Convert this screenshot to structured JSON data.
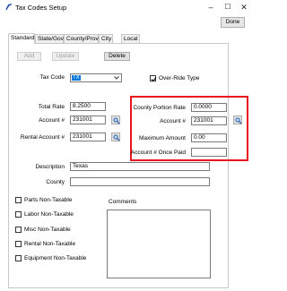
{
  "window": {
    "title": "Tax Codes Setup",
    "minimize": "–",
    "maximize": "☐",
    "close": "✕"
  },
  "done_label": "Done",
  "tabs": [
    "Standard",
    "State/Gov",
    "County/Prov",
    "City",
    "Local"
  ],
  "buttons": {
    "add": "Add",
    "update": "Update",
    "delete": "Delete"
  },
  "tax_code": {
    "label": "Tax Code",
    "value": "TX"
  },
  "override": {
    "label": "Over-Ride Type",
    "checked": true
  },
  "total_rate": {
    "label": "Total Rate",
    "value": "8.2500"
  },
  "account": {
    "label": "Account #",
    "value": "231001"
  },
  "rental_account": {
    "label": "Rental Account #",
    "value": "231001"
  },
  "county_portion_rate": {
    "label": "County Portion Rate",
    "value": "0.0000"
  },
  "county_account": {
    "label": "Account #",
    "value": "231001"
  },
  "maximum_amount": {
    "label": "Maximum Amount",
    "value": "0.00"
  },
  "account_once_paid": {
    "label": "Account # Once Paid",
    "value": ""
  },
  "description": {
    "label": "Description",
    "value": "Texas"
  },
  "county": {
    "label": "County",
    "value": ""
  },
  "comments_label": "Comments",
  "checkboxes": [
    {
      "label": "Parts Non-Taxable",
      "checked": false
    },
    {
      "label": "Labor Non-Taxable",
      "checked": false
    },
    {
      "label": "Misc Non-Taxable",
      "checked": false
    },
    {
      "label": "Rental Non-Taxable",
      "checked": false
    },
    {
      "label": "Equipment Non-Taxable",
      "checked": false
    }
  ],
  "colors": {
    "highlight": "#e8141d",
    "selection": "#0078d7"
  }
}
